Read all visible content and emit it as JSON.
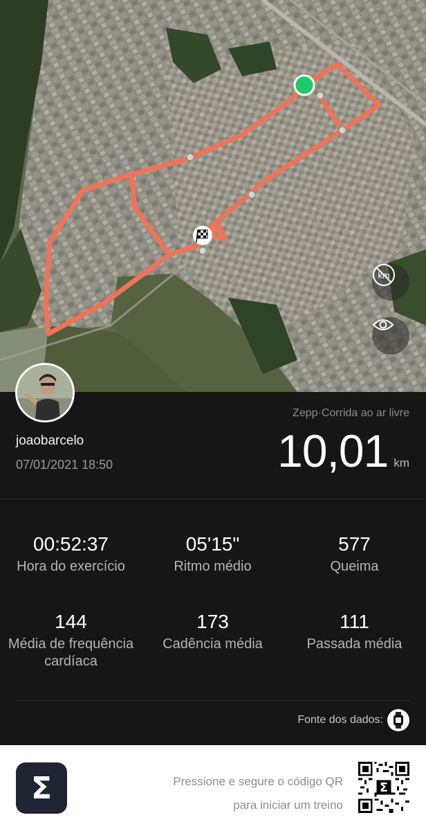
{
  "map": {
    "route_color": "#f07358",
    "start_color": "#1fc96b",
    "controls": {
      "distance_hidden_icon": "km-crossed-icon",
      "visibility_icon": "eye-icon"
    }
  },
  "user": {
    "username": "joaobarcelo",
    "datetime": "07/01/2021 18:50"
  },
  "workout": {
    "sport": "Zepp·Corrida ao ar livre",
    "distance": "10,01",
    "unit": "km"
  },
  "stats": [
    {
      "value": "00:52:37",
      "label": "Hora do exercício"
    },
    {
      "value": "05'15\"",
      "label": "Ritmo médio"
    },
    {
      "value": "577",
      "label": "Queima"
    },
    {
      "value": "144",
      "label": "Média de frequência cardíaca"
    },
    {
      "value": "173",
      "label": "Cadência média"
    },
    {
      "value": "111",
      "label": "Passada média"
    }
  ],
  "source": {
    "label": "Fonte dos dados:",
    "icon": "watch-icon"
  },
  "footer": {
    "line1": "Pressione e segure o código QR",
    "line2": "para iniciar um treino",
    "logo_letter": "Σ"
  }
}
